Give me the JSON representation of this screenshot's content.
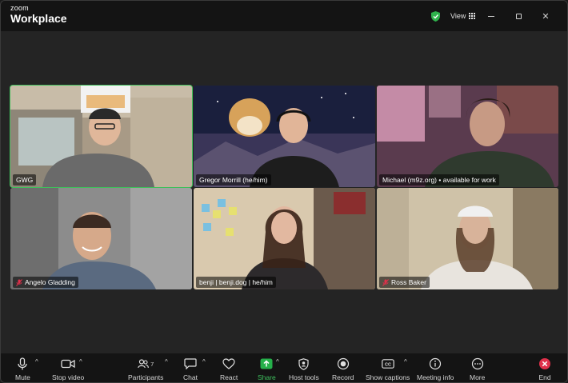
{
  "app": {
    "logo_top": "zoom",
    "logo_main": "Workplace",
    "view_label": "View"
  },
  "participants": [
    {
      "name": "GWG",
      "muted": false,
      "active": true
    },
    {
      "name": "Gregor Morrill (he/him)",
      "muted": false,
      "active": false
    },
    {
      "name": "Michael (m9z.org) • available for work",
      "muted": false,
      "active": false
    },
    {
      "name": "Angelo Gladding",
      "muted": true,
      "active": false
    },
    {
      "name": "benji | benji.dog | he/him",
      "muted": false,
      "active": false
    },
    {
      "name": "Ross Baker",
      "muted": true,
      "active": false
    }
  ],
  "toolbar": {
    "mute": "Mute",
    "stop_video": "Stop video",
    "participants": "Participants",
    "participants_count": "7",
    "chat": "Chat",
    "react": "React",
    "share": "Share",
    "host_tools": "Host tools",
    "record": "Record",
    "show_captions": "Show captions",
    "meeting_info": "Meeting info",
    "more": "More",
    "end": "End"
  },
  "colors": {
    "active_speaker": "#3fbf5b",
    "share": "#25b04a",
    "end": "#e0304a",
    "muted": "#e0304a"
  }
}
